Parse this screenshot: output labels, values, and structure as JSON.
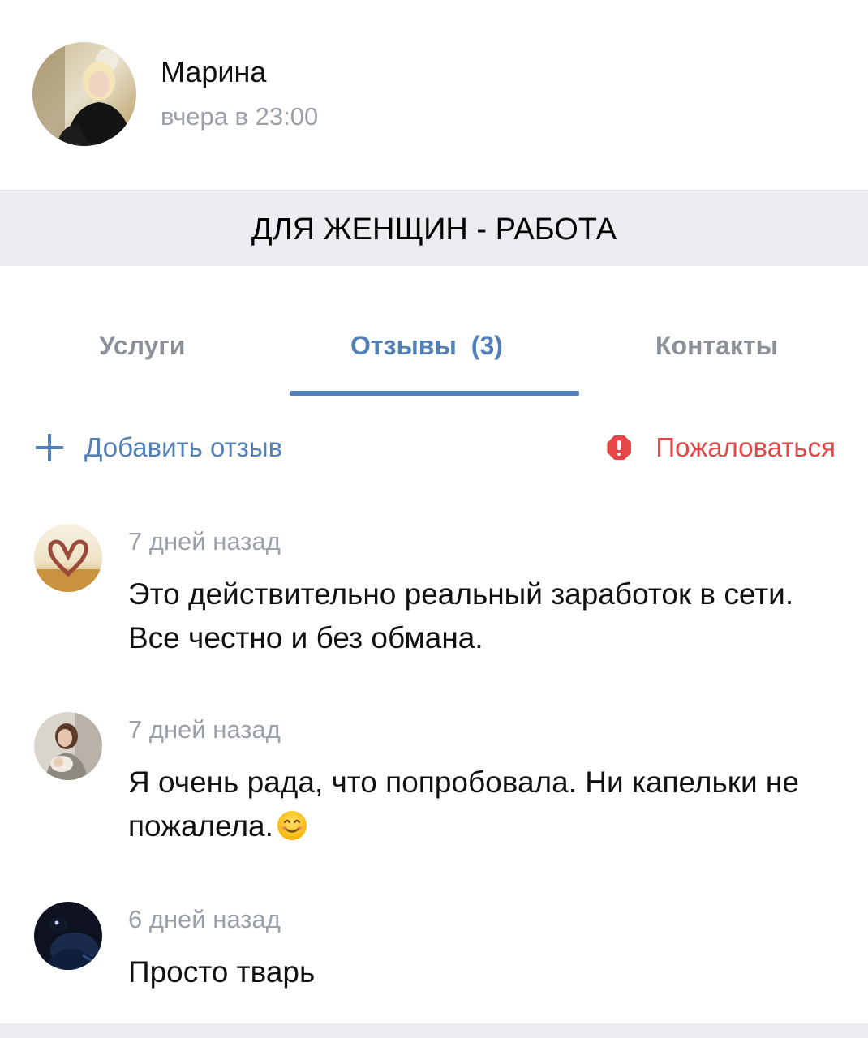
{
  "post": {
    "author_name": "Марина",
    "time": "вчера в 23:00"
  },
  "group": {
    "title": "ДЛЯ ЖЕНЩИН - РАБОТА"
  },
  "tabs": [
    {
      "label": "Услуги",
      "active": false
    },
    {
      "label": "Отзывы",
      "count": "(3)",
      "active": true
    },
    {
      "label": "Контакты",
      "active": false
    }
  ],
  "actions": {
    "add_review": "Добавить отзыв",
    "report": "Пожаловаться"
  },
  "reviews": [
    {
      "date": "7 дней назад",
      "text": "Это действительно реальный заработок в сети. Все честно и без обмана."
    },
    {
      "date": "7 дней назад",
      "text": "Я очень рада, что попробовала. Ни капельки не пожалела.",
      "emoji": "smiling-face-emoji"
    },
    {
      "date": "6 дней назад",
      "text": "Просто тварь"
    }
  ],
  "colors": {
    "accent": "#5181b8",
    "danger": "#e64646",
    "muted": "#9aa0a8",
    "band": "#ebedf0"
  }
}
